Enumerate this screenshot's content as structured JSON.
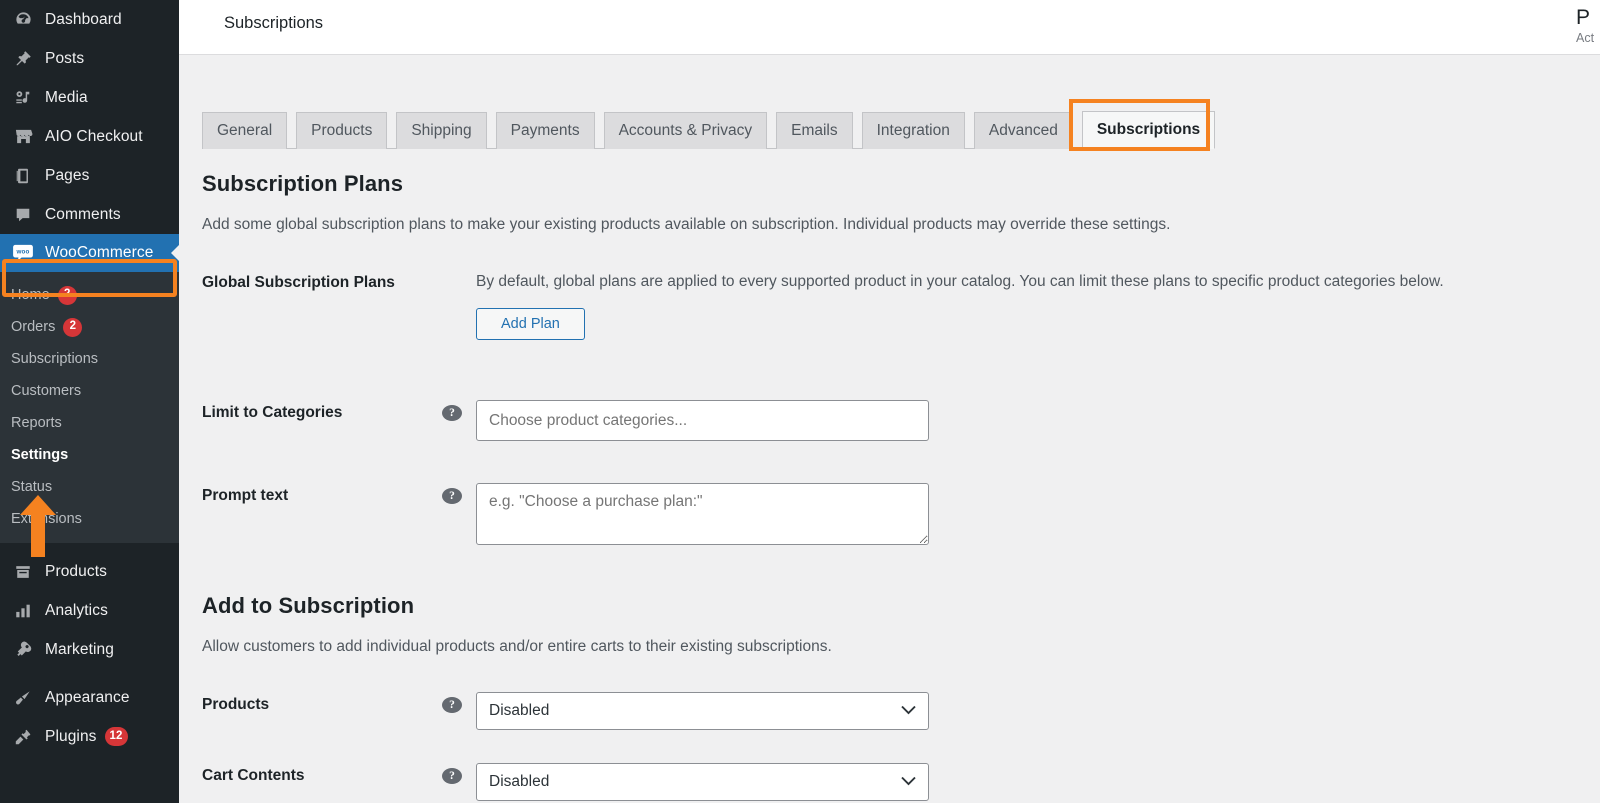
{
  "sidebar": {
    "items": [
      {
        "label": "Dashboard",
        "icon": "dashboard-icon"
      },
      {
        "label": "Posts",
        "icon": "pin-icon"
      },
      {
        "label": "Media",
        "icon": "media-icon"
      },
      {
        "label": "AIO Checkout",
        "icon": "store-icon"
      },
      {
        "label": "Pages",
        "icon": "pages-icon"
      },
      {
        "label": "Comments",
        "icon": "comment-icon"
      }
    ],
    "woocommerce": {
      "label": "WooCommerce",
      "icon": "woo-icon",
      "active": true
    },
    "submenu": [
      {
        "label": "Home",
        "badge": "2"
      },
      {
        "label": "Orders",
        "badge": "2"
      },
      {
        "label": "Subscriptions",
        "badge": ""
      },
      {
        "label": "Customers",
        "badge": ""
      },
      {
        "label": "Reports",
        "badge": ""
      },
      {
        "label": "Settings",
        "badge": "",
        "current": true
      },
      {
        "label": "Status",
        "badge": ""
      },
      {
        "label": "Extensions",
        "badge": ""
      }
    ],
    "items_lower": [
      {
        "label": "Products",
        "icon": "products-icon",
        "badge": ""
      },
      {
        "label": "Analytics",
        "icon": "analytics-icon",
        "badge": ""
      },
      {
        "label": "Marketing",
        "icon": "megaphone-icon",
        "badge": ""
      }
    ],
    "items_lower2": [
      {
        "label": "Appearance",
        "icon": "brush-icon",
        "badge": ""
      },
      {
        "label": "Plugins",
        "icon": "plug-icon",
        "badge": "12"
      }
    ]
  },
  "topbar": {
    "title": "Subscriptions",
    "right_clipped_big": "P",
    "right_clipped_small": "Act"
  },
  "tabs": [
    {
      "label": "General",
      "active": false
    },
    {
      "label": "Products",
      "active": false
    },
    {
      "label": "Shipping",
      "active": false
    },
    {
      "label": "Payments",
      "active": false
    },
    {
      "label": "Accounts & Privacy",
      "active": false
    },
    {
      "label": "Emails",
      "active": false
    },
    {
      "label": "Integration",
      "active": false
    },
    {
      "label": "Advanced",
      "active": false
    },
    {
      "label": "Subscriptions",
      "active": true
    }
  ],
  "section_plans": {
    "heading": "Subscription Plans",
    "description": "Add some global subscription plans to make your existing products available on subscription. Individual products may override these settings.",
    "global_plans": {
      "label": "Global Subscription Plans",
      "description": "By default, global plans are applied to every supported product in your catalog. You can limit these plans to specific product categories below.",
      "add_plan_button": "Add Plan"
    },
    "limit_categories": {
      "label": "Limit to Categories",
      "help": "?",
      "placeholder": "Choose product categories...",
      "value": ""
    },
    "prompt_text": {
      "label": "Prompt text",
      "help": "?",
      "placeholder": "e.g. \"Choose a purchase plan:\"",
      "value": ""
    }
  },
  "section_add_to_subscription": {
    "heading": "Add to Subscription",
    "description": "Allow customers to add individual products and/or entire carts to their existing subscriptions.",
    "products": {
      "label": "Products",
      "help": "?",
      "selected": "Disabled",
      "options": [
        "Disabled"
      ]
    },
    "cart_contents": {
      "label": "Cart Contents",
      "help": "?",
      "selected": "Disabled",
      "options": [
        "Disabled"
      ]
    }
  },
  "annotations": {
    "highlight_color": "#f58220",
    "woocommerce_box": "WooCommerce menu highlighted",
    "settings_arrow": "arrow pointing to Settings",
    "subscriptions_tab_box": "Subscriptions tab highlighted"
  }
}
